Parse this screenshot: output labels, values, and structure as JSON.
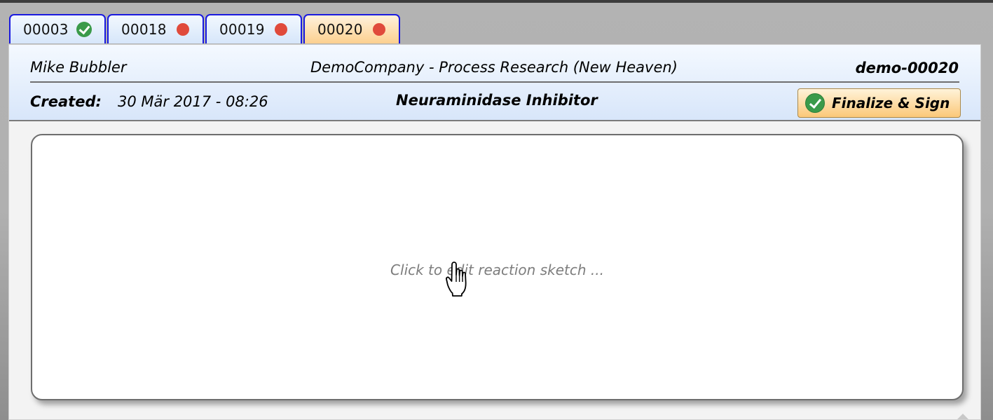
{
  "tabs": [
    {
      "label": "00003",
      "status": "signed",
      "status_color": "#3a9a4a"
    },
    {
      "label": "00018",
      "status": "open",
      "status_color": "#e04a3b"
    },
    {
      "label": "00019",
      "status": "open",
      "status_color": "#e04a3b"
    },
    {
      "label": "00020",
      "status": "open",
      "status_color": "#e04a3b",
      "active": true
    }
  ],
  "header": {
    "user": "Mike Bubbler",
    "company": "DemoCompany - Process Research (New Heaven)",
    "doc_id": "demo-00020",
    "created_label": "Created:",
    "created_value": "30 Mär 2017 - 08:26",
    "title": "Neuraminidase Inhibitor",
    "finalize_label": "Finalize & Sign"
  },
  "sketch": {
    "placeholder": "Click to edit reaction sketch ..."
  },
  "icons": {
    "signed_status": "check-circle-icon",
    "open_status": "red-dot-icon",
    "finalize": "check-circle-icon",
    "pointer": "hand-pointer-icon"
  },
  "colors": {
    "tab_border": "#1a1adf",
    "active_tab": "#fcd08f",
    "header_bg": "#d8e6fa",
    "status_red": "#e04a3b",
    "status_green": "#3a9a4a"
  }
}
